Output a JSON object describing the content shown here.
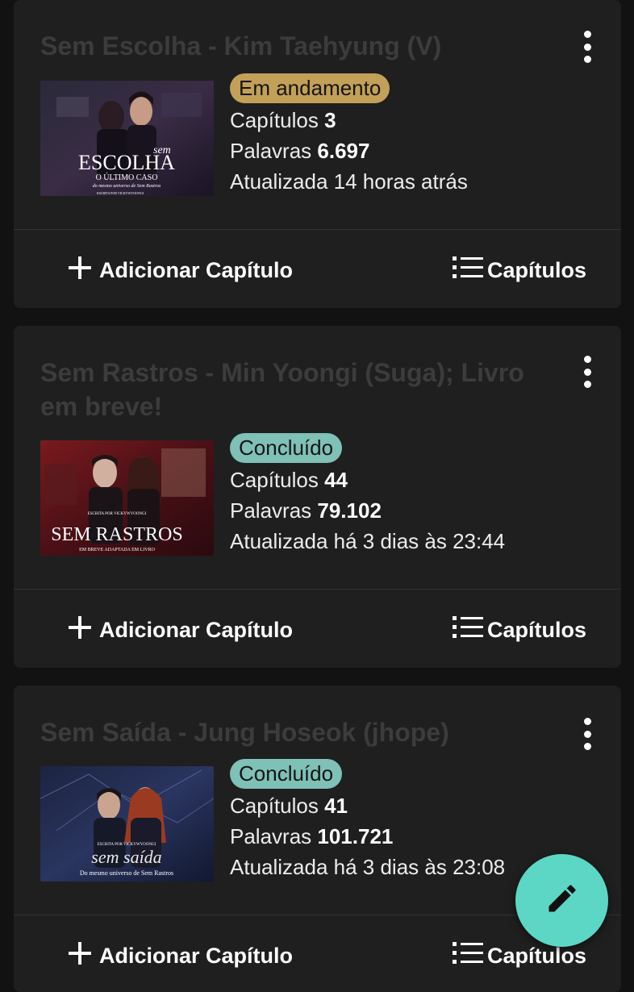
{
  "stories": [
    {
      "title": "Sem Escolha - Kim Taehyung (V)",
      "status": "Em andamento",
      "status_color": "#c3a058",
      "chapters_label": "Capítulos",
      "chapters": "3",
      "words_label": "Palavras",
      "words": "6.697",
      "updated": "Atualizada 14 horas atrás",
      "cover": {
        "line1": "sem",
        "line2": "ESCOLHA",
        "line3": "O ÚLTIMO CASO",
        "line4": "do mesmo universo de Sem Rastros",
        "line5": "ESCRITA POR VICKYWYOONGI"
      },
      "add_chapter": "Adicionar Capítulo",
      "chapters_button": "Capítulos"
    },
    {
      "title": "Sem Rastros - Min Yoongi (Suga); Livro em breve!",
      "status": "Concluído",
      "status_color": "#7fc0b7",
      "chapters_label": "Capítulos",
      "chapters": "44",
      "words_label": "Palavras",
      "words": "79.102",
      "updated": "Atualizada há 3 dias às 23:44",
      "cover": {
        "line1": "ESCRITA POR VICKYWYOONGI",
        "line2": "SEM RASTROS",
        "line3": "EM BREVE ADAPTADA EM LIVRO"
      },
      "add_chapter": "Adicionar Capítulo",
      "chapters_button": "Capítulos"
    },
    {
      "title": "Sem Saída - Jung Hoseok (jhope)",
      "status": "Concluído",
      "status_color": "#7fc0b7",
      "chapters_label": "Capítulos",
      "chapters": "41",
      "words_label": "Palavras",
      "words": "101.721",
      "updated": "Atualizada há 3 dias às 23:08",
      "cover": {
        "line1": "ESCRITA POR VICKYWYOONGI",
        "line2": "sem saída",
        "line3": "Do mesmo universo de Sem Rastros"
      },
      "add_chapter": "Adicionar Capítulo",
      "chapters_button": "Capítulos"
    }
  ],
  "icons": {
    "menu": "more-vert-icon",
    "add": "plus-icon",
    "list": "list-icon",
    "fab": "pencil-icon"
  },
  "colors": {
    "background": "#121212",
    "card": "#1f1f1f",
    "fab": "#5cd7c6"
  }
}
